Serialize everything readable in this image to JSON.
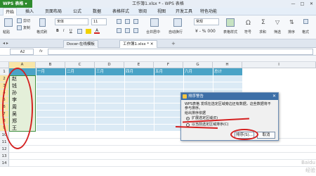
{
  "app": {
    "name": "WPS 表格",
    "window_title": "工作簿1.xlsx * - WPS 表格"
  },
  "window_controls": [
    "—",
    "□",
    "✕"
  ],
  "menu": {
    "items": [
      "开始",
      "插入",
      "页面布局",
      "公式",
      "数据",
      "表格样式",
      "审阅",
      "视图",
      "开发工具",
      "特色功能"
    ],
    "active": "开始"
  },
  "ribbon": {
    "paste": "粘贴",
    "cut": "剪切",
    "copy": "复制",
    "format_painter": "格式刷",
    "font_name": "宋体",
    "font_size": "11",
    "merge_center": "合并居中",
    "wrap_text": "自动换行",
    "format_label": "常规",
    "table_style": "表格样式",
    "symbol": "符号",
    "sum": "求和",
    "filter": "筛选",
    "sort": "排序",
    "format": "格式"
  },
  "doc_tabs": [
    {
      "label": "Docer-在线模板",
      "selected": false
    },
    {
      "label": "工作簿1.xlsx *",
      "selected": true
    }
  ],
  "formula_bar": {
    "name_box": "A2",
    "fx": "fx",
    "value": ""
  },
  "grid": {
    "columns": [
      "A",
      "B",
      "C",
      "D",
      "E",
      "F",
      "G",
      "H",
      "I"
    ],
    "header_row": [
      "",
      "一月",
      "二月",
      "三月",
      "四月",
      "五月",
      "六月",
      "总计"
    ],
    "names": [
      "赵",
      "钱",
      "孙",
      "李",
      "周",
      "吴",
      "郑",
      "王"
    ],
    "row_numbers": [
      "1",
      "2",
      "3",
      "4",
      "5",
      "6",
      "7",
      "8",
      "9",
      "10",
      "11",
      "12",
      "13",
      "14"
    ],
    "header_color": "#4aa3c6",
    "band_color": "#dbeaf5"
  },
  "dialog": {
    "title": "排序警告",
    "message_line1": "WPS表格 发现在选定区域旁边还有数据，这些数据将不",
    "message_line2": "参与排序。",
    "prompt": "给出排序依据",
    "option_expand": "扩展选定区域(E)",
    "option_current": "以当前选定区域排序(C)",
    "sort_button": "排序(S)...",
    "cancel_button": "取消"
  },
  "watermark": {
    "line1": "Baidu",
    "line2": "经验"
  },
  "annotation_color": "#d42020"
}
